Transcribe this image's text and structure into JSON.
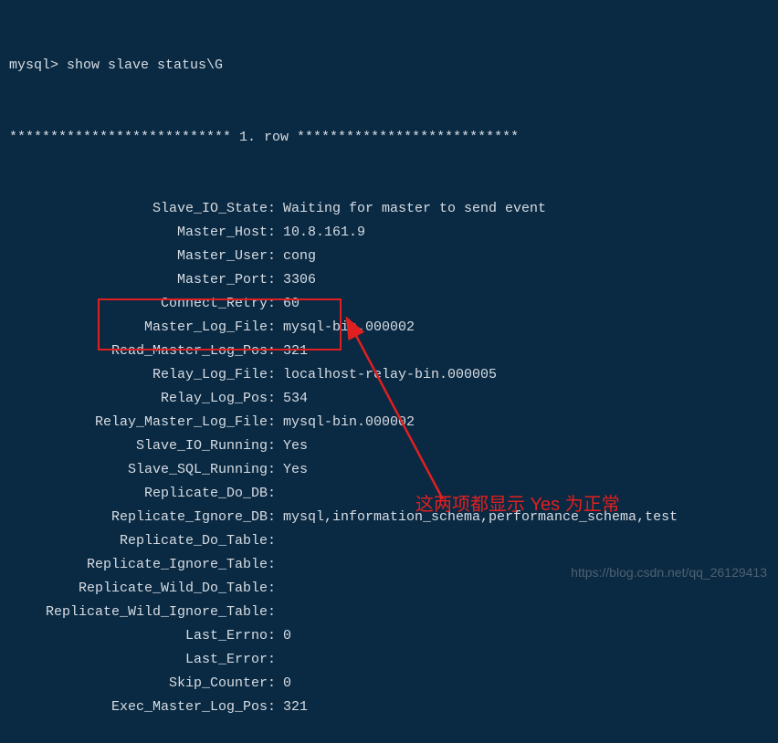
{
  "prompt": "mysql> show slave status\\G",
  "row_header": "*************************** 1. row ***************************",
  "rows": [
    {
      "label": "Slave_IO_State:",
      "value": "Waiting for master to send event"
    },
    {
      "label": "Master_Host:",
      "value": "10.8.161.9"
    },
    {
      "label": "Master_User:",
      "value": "cong"
    },
    {
      "label": "Master_Port:",
      "value": "3306"
    },
    {
      "label": "Connect_Retry:",
      "value": "60"
    },
    {
      "label": "Master_Log_File:",
      "value": "mysql-bin.000002"
    },
    {
      "label": "Read_Master_Log_Pos:",
      "value": "321"
    },
    {
      "label": "Relay_Log_File:",
      "value": "localhost-relay-bin.000005"
    },
    {
      "label": "Relay_Log_Pos:",
      "value": "534"
    },
    {
      "label": "Relay_Master_Log_File:",
      "value": "mysql-bin.000002"
    },
    {
      "label": "Slave_IO_Running:",
      "value": "Yes"
    },
    {
      "label": "Slave_SQL_Running:",
      "value": "Yes"
    },
    {
      "label": "Replicate_Do_DB:",
      "value": ""
    },
    {
      "label": "Replicate_Ignore_DB:",
      "value": "mysql,information_schema,performance_schema,test"
    },
    {
      "label": "Replicate_Do_Table:",
      "value": ""
    },
    {
      "label": "Replicate_Ignore_Table:",
      "value": ""
    },
    {
      "label": "Replicate_Wild_Do_Table:",
      "value": ""
    },
    {
      "label": "Replicate_Wild_Ignore_Table:",
      "value": ""
    },
    {
      "label": "Last_Errno:",
      "value": "0"
    },
    {
      "label": "Last_Error:",
      "value": ""
    },
    {
      "label": "Skip_Counter:",
      "value": "0"
    },
    {
      "label": "Exec_Master_Log_Pos:",
      "value": "321"
    }
  ],
  "annotation_text": "这两项都显示 Yes 为正常",
  "watermark": "https://blog.csdn.net/qq_26129413",
  "highlight_color": "#e02020"
}
